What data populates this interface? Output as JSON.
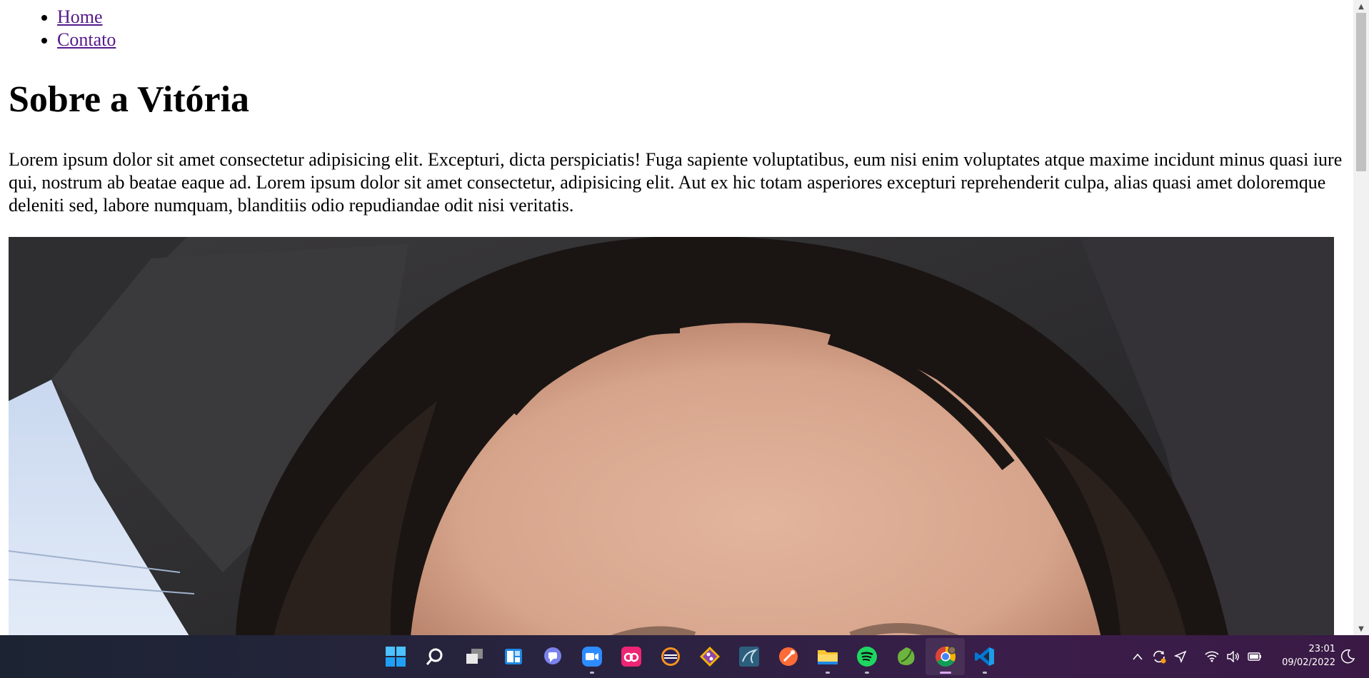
{
  "nav": {
    "items": [
      {
        "label": "Home"
      },
      {
        "label": "Contato"
      }
    ]
  },
  "page": {
    "title": "Sobre a Vitória",
    "paragraph": "Lorem ipsum dolor sit amet consectetur adipisicing elit. Excepturi, dicta perspiciatis! Fuga sapiente voluptatibus, eum nisi enim voluptates atque maxime incidunt minus quasi iure qui, nostrum ab beatae eaque ad. Lorem ipsum dolor sit amet consectetur, adipisicing elit. Aut ex hic totam asperiores excepturi reprehenderit culpa, alias quasi amet doloremque deleniti sed, labore numquam, blanditiis odio repudiandae odit nisi veritatis."
  },
  "colors": {
    "link": "#551A8B",
    "taskbar_left": "#1c2433",
    "taskbar_right": "#3a1a45",
    "scroll_thumb": "#c1c1c1"
  },
  "taskbar": {
    "apps": [
      {
        "icon": "windows-start-icon",
        "running": false
      },
      {
        "icon": "search-icon",
        "running": false
      },
      {
        "icon": "task-view-icon",
        "running": false
      },
      {
        "icon": "widgets-icon",
        "running": false
      },
      {
        "icon": "teams-chat-icon",
        "running": false
      },
      {
        "icon": "zoom-icon",
        "running": true
      },
      {
        "icon": "creative-cloud-icon",
        "running": false
      },
      {
        "icon": "eclipse-icon",
        "running": false
      },
      {
        "icon": "git-icon",
        "running": false
      },
      {
        "icon": "mysql-workbench-icon",
        "running": false
      },
      {
        "icon": "postman-icon",
        "running": false
      },
      {
        "icon": "file-explorer-icon",
        "running": true
      },
      {
        "icon": "spotify-icon",
        "running": true
      },
      {
        "icon": "spring-tools-icon",
        "running": false
      },
      {
        "icon": "chrome-icon",
        "running": true,
        "active": true
      },
      {
        "icon": "vscode-icon",
        "running": true
      }
    ],
    "tray": [
      "chevron-up-icon",
      "sync-icon",
      "location-icon",
      "wifi-icon",
      "volume-icon",
      "battery-icon"
    ],
    "time": "23:01",
    "date": "09/02/2022"
  }
}
